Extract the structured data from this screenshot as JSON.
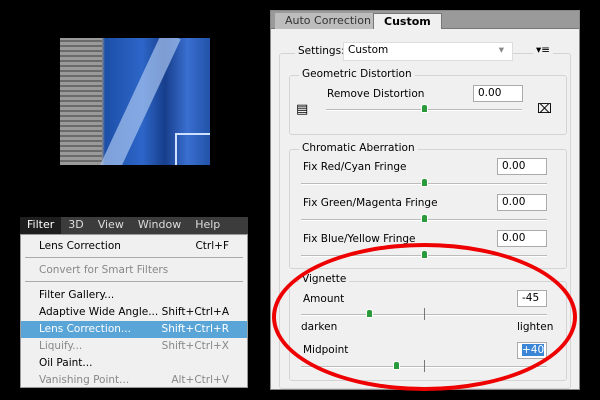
{
  "menubar": {
    "items": [
      "Filter",
      "3D",
      "View",
      "Window",
      "Help"
    ]
  },
  "menu": {
    "items": [
      {
        "label": "Lens Correction",
        "shortcut": "Ctrl+F",
        "state": "normal"
      },
      {
        "label": "Convert for Smart Filters",
        "shortcut": "",
        "state": "disabled"
      },
      {
        "label": "Filter Gallery...",
        "shortcut": "",
        "state": "normal"
      },
      {
        "label": "Adaptive Wide Angle...",
        "shortcut": "Shift+Ctrl+A",
        "state": "normal"
      },
      {
        "label": "Lens Correction...",
        "shortcut": "Shift+Ctrl+R",
        "state": "selected"
      },
      {
        "label": "Liquify...",
        "shortcut": "Shift+Ctrl+X",
        "state": "disabled"
      },
      {
        "label": "Oil Paint...",
        "shortcut": "",
        "state": "normal"
      },
      {
        "label": "Vanishing Point...",
        "shortcut": "Alt+Ctrl+V",
        "state": "disabled"
      }
    ]
  },
  "panel": {
    "tabs": [
      "Auto Correction",
      "Custom"
    ],
    "active_tab": "Custom",
    "settings_label": "Settings:",
    "settings_value": "Custom",
    "geometric": {
      "title": "Geometric Distortion",
      "label": "Remove Distortion",
      "value": "0.00",
      "slider": 0
    },
    "chromatic": {
      "title": "Chromatic Aberration",
      "items": [
        {
          "label": "Fix Red/Cyan Fringe",
          "value": "0.00",
          "slider": 0
        },
        {
          "label": "Fix Green/Magenta Fringe",
          "value": "0.00",
          "slider": 0
        },
        {
          "label": "Fix Blue/Yellow Fringe",
          "value": "0.00",
          "slider": 0
        }
      ]
    },
    "vignette": {
      "title": "Vignette",
      "amount_label": "Amount",
      "amount_value": "-45",
      "amount_slider": -45,
      "darken": "darken",
      "lighten": "lighten",
      "midpoint_label": "Midpoint",
      "midpoint_value": "+40",
      "midpoint_slider": 40
    }
  },
  "colors": {
    "highlight": "#5aa5d8",
    "annotation": "#ee0000",
    "thumb": "#2a9a3a"
  }
}
